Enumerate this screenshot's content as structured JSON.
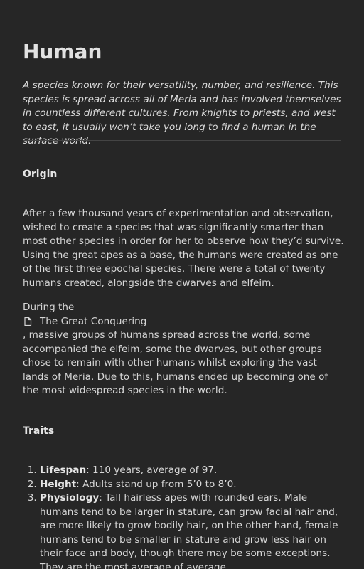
{
  "title": "Human",
  "intro": "A species known for their versatility, number, and resilience. This species is spread across all of Meria and has involved themselves in countless different cultures. From knights to priests, and west to east, it usually won’t take you long to find a human in the surface world.",
  "origin": {
    "heading": "Origin",
    "paragraph1": "After a few thousand years of experimentation and observation, wished to create a species that was significantly smarter than most other species in order for her to observe how they’d survive. Using the great apes as a base, the humans were created as one of the first three epochal species. There were a total of twenty humans created, alongside the dwarves and elfeim.",
    "paragraph2_prefix": "During the",
    "link_label": "The Great Conquering",
    "link_icon": "document-icon",
    "paragraph2_suffix": ", massive groups of humans spread across the world, some accompanied the elfeim, some the dwarves, but other groups chose to remain with other humans whilst exploring the vast lands of Meria. Due to this, humans ended up becoming one of the most widespread species in the world."
  },
  "traits": {
    "heading": "Traits",
    "items": [
      {
        "label": "Lifespan",
        "text": ": 110 years, average of 97."
      },
      {
        "label": "Height",
        "text": ": Adults stand up from 5’0 to 8’0."
      },
      {
        "label": "Physiology",
        "text": ": Tall hairless apes with rounded ears. Male humans tend to be larger in stature, can grow facial hair and, are more likely to grow bodily hair, on the other hand, female humans tend to be smaller in stature and grow less hair on their face and body, though there may be some exceptions. They are the most average of average."
      }
    ]
  }
}
